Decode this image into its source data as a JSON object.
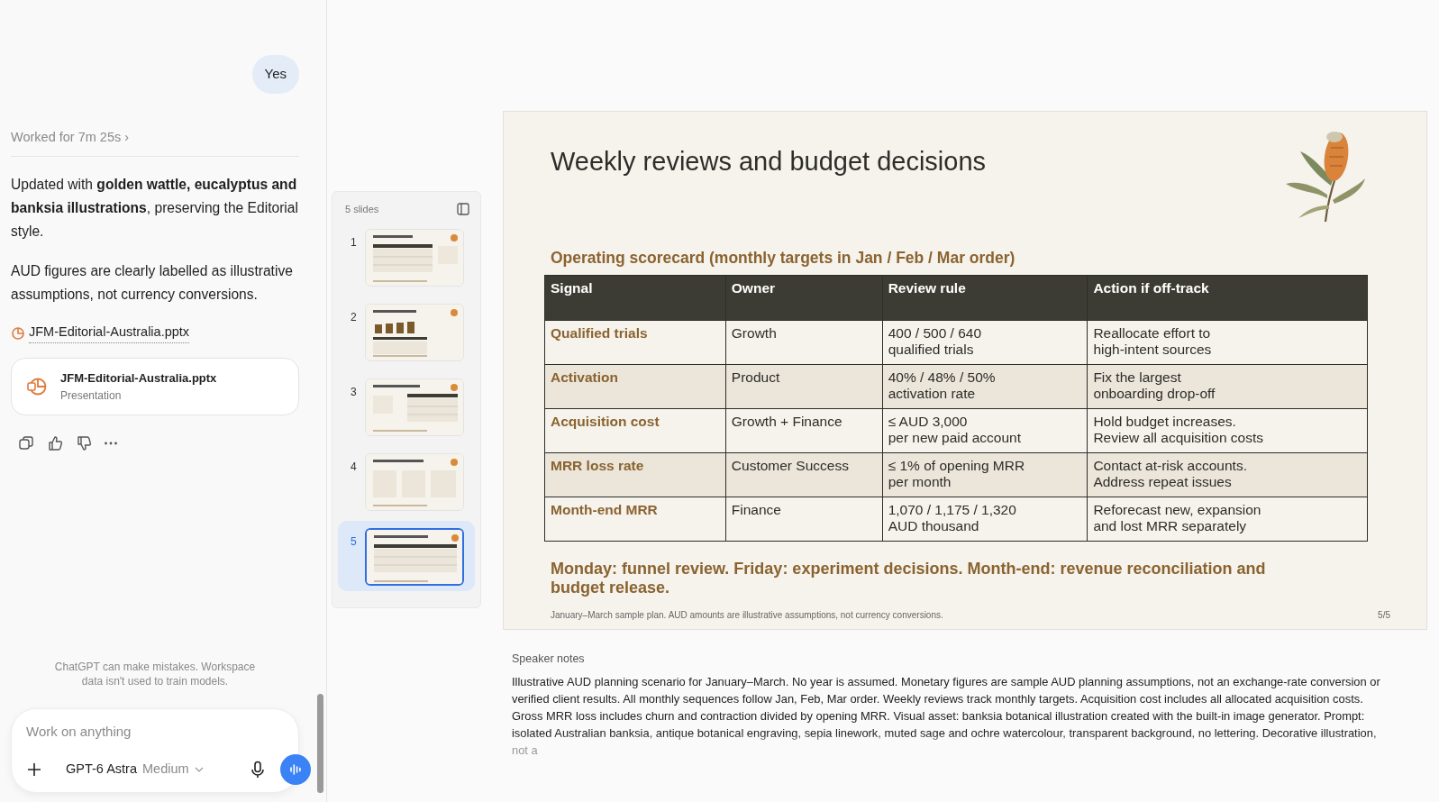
{
  "chat": {
    "user_message": "Yes",
    "worked": "Worked for 7m 25s",
    "chevron": "›",
    "paragraphs": [
      "Updated with **golden wattle, eucalyptus and banksia illustrations**, preserving the Editorial style.",
      "AUD figures are clearly labelled as illustrative assumptions, not currency conversions."
    ],
    "file_link": "JFM-Editorial-Australia.pptx",
    "file_card": {
      "name": "JFM-Editorial-Australia.pptx",
      "type": "Presentation"
    },
    "disclaimer": "ChatGPT can make mistakes. Workspace data isn't used to train models.",
    "composer": {
      "placeholder": "Work on anything",
      "model": "GPT-6 Astra",
      "effort": "Medium"
    }
  },
  "slides_panel": {
    "count_label": "5 slides",
    "thumbnails": [
      {
        "number": "1",
        "selected": false
      },
      {
        "number": "2",
        "selected": false
      },
      {
        "number": "3",
        "selected": false
      },
      {
        "number": "4",
        "selected": false
      },
      {
        "number": "5",
        "selected": true
      }
    ]
  },
  "slide": {
    "title": "Weekly reviews and budget decisions",
    "table_caption": "Operating scorecard (monthly targets in Jan / Feb / Mar order)",
    "table": {
      "columns": [
        "Signal",
        "Owner",
        "Review rule",
        "Action if off-track"
      ],
      "rows": [
        {
          "cells": [
            "Qualified trials",
            "Growth",
            "400 / 500 / 640\nqualified trials",
            "Reallocate effort to\nhigh-intent sources"
          ]
        },
        {
          "cells": [
            "Activation",
            "Product",
            "40% / 48% / 50%\nactivation rate",
            "Fix the largest\nonboarding drop-off"
          ]
        },
        {
          "cells": [
            "Acquisition cost",
            "Growth + Finance",
            "≤ AUD 3,000\nper new paid account",
            "Hold budget increases.\nReview all acquisition costs"
          ]
        },
        {
          "cells": [
            "MRR loss rate",
            "Customer Success",
            "≤ 1% of opening MRR\nper month",
            "Contact at-risk accounts.\nAddress repeat issues"
          ]
        },
        {
          "cells": [
            "Month-end MRR",
            "Finance",
            "1,070 / 1,175 / 1,320\nAUD thousand",
            "Reforecast new, expansion\nand lost MRR separately"
          ]
        }
      ]
    },
    "callout": "Monday: funnel review. Friday: experiment decisions. Month-end: revenue reconciliation and budget release.",
    "footnote": "January–March sample plan. AUD amounts are illustrative assumptions, not currency conversions.",
    "page": "5/5"
  },
  "speaker_notes": {
    "label": "Speaker notes",
    "text": "Illustrative AUD planning scenario for January–March. No year is assumed. Monetary figures are sample AUD planning assumptions, not an exchange-rate conversion or verified client results. All monthly sequences follow Jan, Feb, Mar order. Weekly reviews track monthly targets. Acquisition cost includes all allocated acquisition costs. Gross MRR loss includes churn and contraction divided by opening MRR. Visual asset: banksia botanical illustration created with the built-in image generator. Prompt: isolated Australian banksia, antique botanical engraving, sepia linework, muted sage and ochre watercolour, transparent background, no lettering. Decorative illustration, not a"
  }
}
